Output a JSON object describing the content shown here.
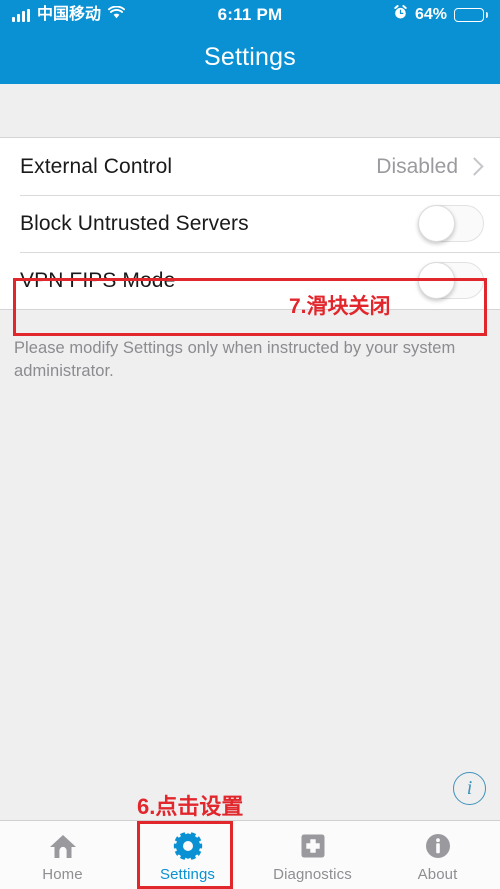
{
  "status_bar": {
    "carrier": "中国移动",
    "time": "6:11 PM",
    "battery_percent": "64%",
    "battery_level": 64,
    "signal_icon": "signal-bars-icon",
    "wifi_icon": "wifi-icon",
    "alarm_icon": "alarm-clock-icon"
  },
  "nav": {
    "title": "Settings",
    "background_color": "#0a91d3"
  },
  "settings": {
    "rows": [
      {
        "label": "External Control",
        "value": "Disabled",
        "type": "disclosure"
      },
      {
        "label": "Block Untrusted Servers",
        "type": "toggle",
        "toggle_state": "off"
      },
      {
        "label": "VPN FIPS Mode",
        "type": "toggle",
        "toggle_state": "off"
      }
    ],
    "footer_note": "Please modify Settings only when instructed by your system administrator."
  },
  "annotations": {
    "color": "#e1262c",
    "toggle_note": "7.滑块关闭",
    "tab_note": "6.点击设置"
  },
  "info_button": {
    "glyph": "i",
    "color": "#3f93ba"
  },
  "tab_bar": {
    "active_color": "#0a91d3",
    "inactive_color": "#9a9a9e",
    "items": [
      {
        "label": "Home",
        "icon": "home-icon",
        "active": false
      },
      {
        "label": "Settings",
        "icon": "gear-icon",
        "active": true
      },
      {
        "label": "Diagnostics",
        "icon": "plus-square-icon",
        "active": false
      },
      {
        "label": "About",
        "icon": "info-circle-icon",
        "active": false
      }
    ]
  }
}
